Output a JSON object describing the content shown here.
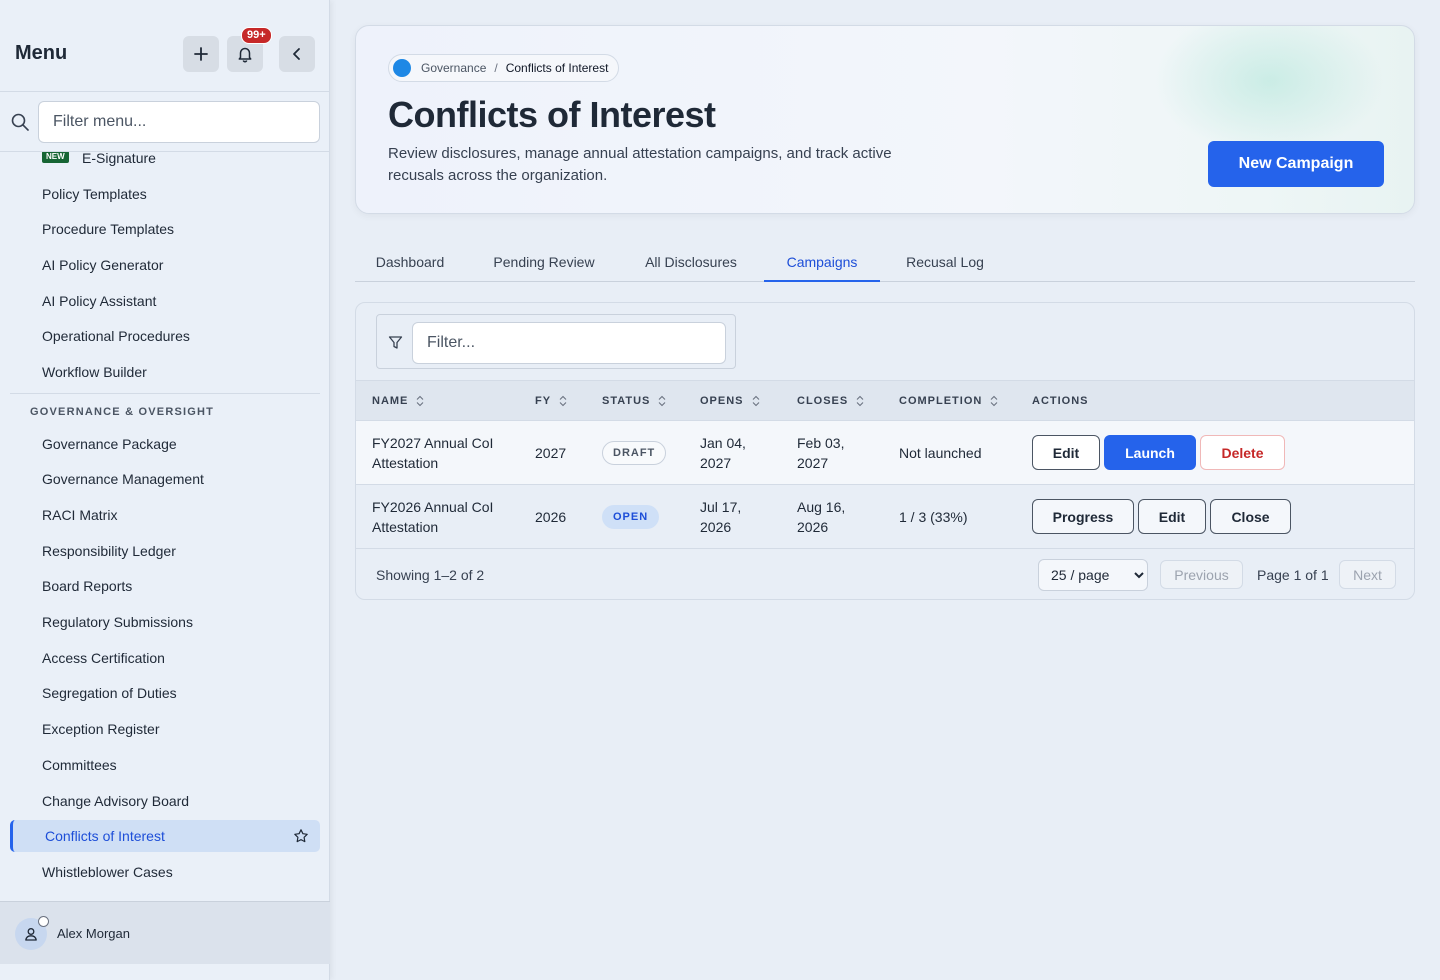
{
  "sidebar": {
    "title": "Menu",
    "notification_count": "99+",
    "filter_placeholder": "Filter menu...",
    "new_badge": "NEW",
    "items_top": [
      "E-Signature",
      "Policy Templates",
      "Procedure Templates",
      "AI Policy Generator",
      "AI Policy Assistant",
      "Operational Procedures",
      "Workflow Builder"
    ],
    "section_label": "GOVERNANCE & OVERSIGHT",
    "items_governance": [
      "Governance Package",
      "Governance Management",
      "RACI Matrix",
      "Responsibility Ledger",
      "Board Reports",
      "Regulatory Submissions",
      "Access Certification",
      "Segregation of Duties",
      "Exception Register",
      "Committees",
      "Change Advisory Board",
      "Conflicts of Interest",
      "Whistleblower Cases"
    ],
    "active_item": "Conflicts of Interest",
    "user_name": "Alex Morgan"
  },
  "header": {
    "breadcrumb_parent": "Governance",
    "breadcrumb_sep": "/",
    "breadcrumb_current": "Conflicts of Interest",
    "title": "Conflicts of Interest",
    "description": "Review disclosures, manage annual attestation campaigns, and track active recusals across the organization.",
    "primary_button": "New Campaign"
  },
  "tabs": [
    "Dashboard",
    "Pending Review",
    "All Disclosures",
    "Campaigns",
    "Recusal Log"
  ],
  "active_tab": "Campaigns",
  "table": {
    "filter_placeholder": "Filter...",
    "columns": [
      "NAME",
      "FY",
      "STATUS",
      "OPENS",
      "CLOSES",
      "COMPLETION",
      "ACTIONS"
    ],
    "rows": [
      {
        "name_line1": "FY2027 Annual CoI",
        "name_line2": "Attestation",
        "fy": "2027",
        "status": "DRAFT",
        "opens_line1": "Jan 04,",
        "opens_line2": "2027",
        "closes_line1": "Feb 03,",
        "closes_line2": "2027",
        "completion": "Not launched",
        "actions": [
          "Edit",
          "Launch",
          "Delete"
        ]
      },
      {
        "name_line1": "FY2026 Annual CoI",
        "name_line2": "Attestation",
        "fy": "2026",
        "status": "OPEN",
        "opens_line1": "Jul 17,",
        "opens_line2": "2026",
        "closes_line1": "Aug 16,",
        "closes_line2": "2026",
        "completion": "1 / 3 (33%)",
        "actions": [
          "Progress",
          "Edit",
          "Close"
        ]
      }
    ],
    "showing": "Showing 1–2 of 2",
    "page_size": "25 / page",
    "previous": "Previous",
    "page_info": "Page 1 of 1",
    "next": "Next"
  },
  "colors": {
    "accent": "#2563eb",
    "danger": "#c62828",
    "new_badge": "#166534"
  }
}
